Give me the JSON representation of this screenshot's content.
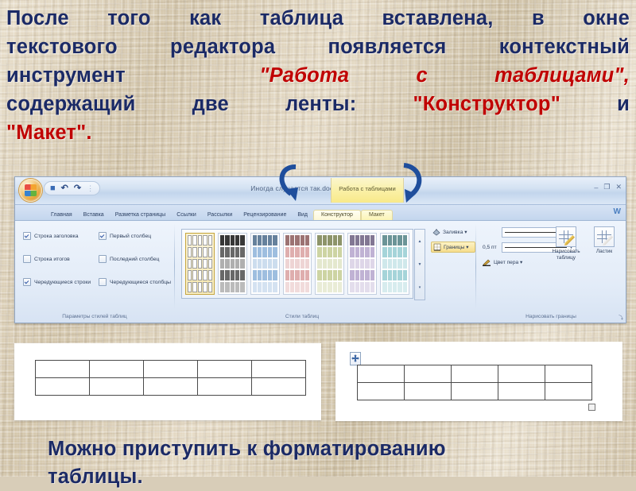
{
  "slide": {
    "intro_line1": "После того как таблица вставлена, в окне",
    "intro_line2": "текстового редактора появляется контекстный",
    "intro_line3_a": "инструмент",
    "intro_line3_b": "\"Работа с таблицами\",",
    "intro_line4_a": "содержащий две ленты:",
    "intro_line4_b": "\"Конструктор\"",
    "intro_line4_c": "и",
    "intro_line5": "\"Макет\".",
    "outro_line1": "Можно приступить к форматированию",
    "outro_line2": "таблицы.",
    "text_color": "#1b2a66",
    "highlight_color": "#c00000",
    "background_color": "#cfc3ad"
  },
  "word": {
    "titlebar": {
      "document_title": "Иногда случается так.docx - Microsoft Word",
      "office_button": "Office",
      "qat": [
        "save-icon",
        "undo-icon",
        "redo-icon",
        "customize-icon"
      ],
      "qat_glyphs": [
        "■",
        "↶",
        "↷",
        "⋮"
      ],
      "contextual_group_label": "Работа с таблицами",
      "minimize": "–",
      "restore": "❐",
      "close": "✕",
      "help_badge": "W"
    },
    "tabs": [
      {
        "label": "Главная",
        "contextual": false,
        "active": false
      },
      {
        "label": "Вставка",
        "contextual": false,
        "active": false
      },
      {
        "label": "Разметка страницы",
        "contextual": false,
        "active": false
      },
      {
        "label": "Ссылки",
        "contextual": false,
        "active": false
      },
      {
        "label": "Рассылки",
        "contextual": false,
        "active": false
      },
      {
        "label": "Рецензирование",
        "contextual": false,
        "active": false
      },
      {
        "label": "Вид",
        "contextual": false,
        "active": false
      },
      {
        "label": "Конструктор",
        "contextual": true,
        "active": true
      },
      {
        "label": "Макет",
        "contextual": true,
        "active": false
      }
    ],
    "ribbon": {
      "group_options": {
        "label": "Параметры стилей таблиц",
        "checkboxes": [
          {
            "label": "Строка заголовка",
            "checked": true
          },
          {
            "label": "Первый столбец",
            "checked": true
          },
          {
            "label": "Строка итогов",
            "checked": false
          },
          {
            "label": "Последний столбец",
            "checked": false
          },
          {
            "label": "Чередующиеся строки",
            "checked": true
          },
          {
            "label": "Чередующиеся столбцы",
            "checked": false
          }
        ]
      },
      "group_styles": {
        "label": "Стили таблиц",
        "thumbnails": [
          {
            "name": "table-style-plain",
            "accent": "#7a7a7a",
            "selected": true
          },
          {
            "name": "table-style-dark",
            "accent": "#4d4d4d",
            "selected": false
          },
          {
            "name": "table-style-blue",
            "accent": "#8db3d9",
            "selected": false
          },
          {
            "name": "table-style-red",
            "accent": "#d9a0a0",
            "selected": false
          },
          {
            "name": "table-style-olive",
            "accent": "#c4cd93",
            "selected": false
          },
          {
            "name": "table-style-purple",
            "accent": "#b5a5cc",
            "selected": false
          },
          {
            "name": "table-style-aqua",
            "accent": "#95cdd2",
            "selected": false
          }
        ],
        "scroll_up": "▲",
        "scroll_down": "▼",
        "scroll_more": "▾"
      },
      "group_fill": {
        "fill_label": "Заливка ▾",
        "borders_label": "Границы ▾"
      },
      "group_draw": {
        "label": "Нарисовать границы",
        "line_style_value": "",
        "line_width_value": "0,5 пт",
        "pen_color_label": "Цвет пера ▾",
        "draw_table_label": "Нарисовать таблицу",
        "eraser_label": "Ластик",
        "dialog_launcher": "⤵"
      }
    }
  },
  "documents": {
    "left_panel": {
      "table": {
        "rows": 2,
        "cols": 5
      }
    },
    "right_panel": {
      "table": {
        "rows": 2,
        "cols": 5
      },
      "move_handle": "move-handle-icon",
      "resize_handle": "resize-handle-icon"
    }
  },
  "annotations": {
    "arrow_left": "curved-arrow-pointing-to-contextual-tab",
    "arrow_right": "curved-arrow-pointing-to-contextual-tab",
    "arrow_color": "#1f4e9c"
  }
}
